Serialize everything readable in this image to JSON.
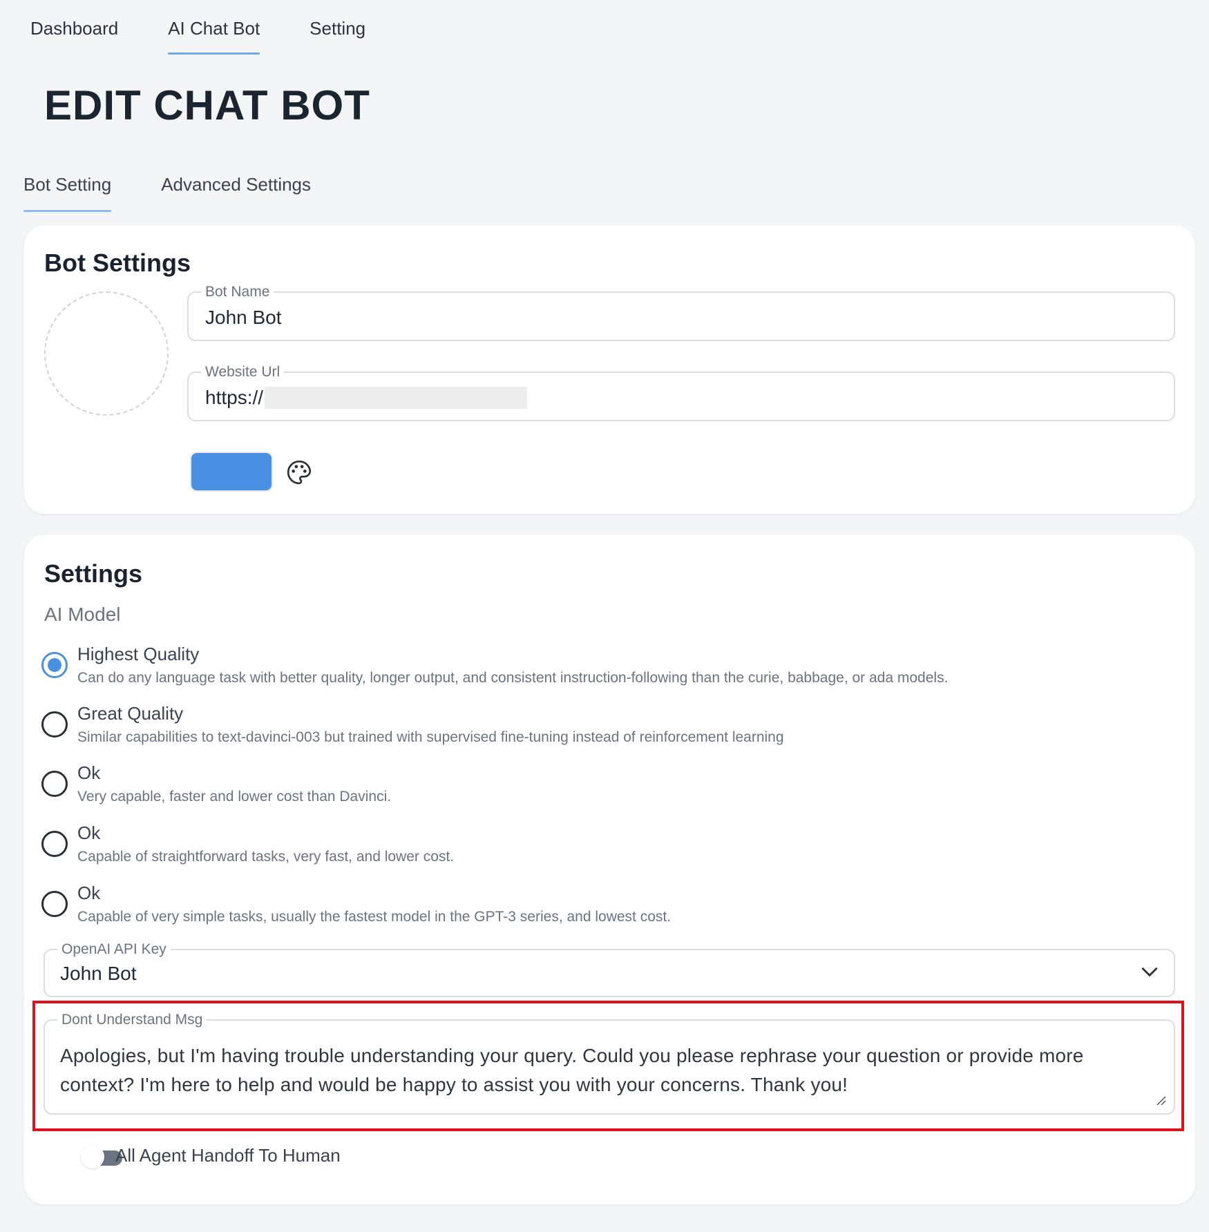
{
  "nav": {
    "tabs": [
      {
        "label": "Dashboard"
      },
      {
        "label": "AI Chat Bot"
      },
      {
        "label": "Setting"
      }
    ],
    "active": "AI Chat Bot"
  },
  "page": {
    "title": "EDIT CHAT BOT"
  },
  "subtabs": [
    {
      "label": "Bot Setting"
    },
    {
      "label": "Advanced Settings"
    }
  ],
  "bot_settings": {
    "title": "Bot Settings",
    "bot_name": {
      "label": "Bot Name",
      "value": "John Bot"
    },
    "website_url": {
      "label": "Website Url",
      "value": "https://"
    },
    "color": "#4a90e2",
    "palette_icon": "palette-icon"
  },
  "settings": {
    "title": "Settings",
    "ai_model_label": "AI Model",
    "models": [
      {
        "title": "Highest Quality",
        "desc": "Can do any language task with better quality, longer output, and consistent instruction-following than the curie, babbage, or ada models.",
        "checked": true
      },
      {
        "title": "Great Quality",
        "desc": "Similar capabilities to text-davinci-003 but trained with supervised fine-tuning instead of reinforcement learning",
        "checked": false
      },
      {
        "title": "Ok",
        "desc": "Very capable, faster and lower cost than Davinci.",
        "checked": false
      },
      {
        "title": "Ok",
        "desc": "Capable of straightforward tasks, very fast, and lower cost.",
        "checked": false
      },
      {
        "title": "Ok",
        "desc": "Capable of very simple tasks, usually the fastest model in the GPT-3 series, and lowest cost.",
        "checked": false
      }
    ],
    "api_key": {
      "label": "OpenAI API Key",
      "value": "John Bot"
    },
    "dont_understand": {
      "label": "Dont Understand Msg",
      "value": "Apologies, but I'm having trouble understanding your query. Could you please rephrase your question or provide more context? I'm here to help and would be happy to assist you with your concerns. Thank you!"
    },
    "handoff": {
      "label": "All Agent Handoff To Human",
      "enabled": false
    }
  },
  "colors": {
    "accent": "#4a90e2",
    "highlight": "#e0101c"
  }
}
